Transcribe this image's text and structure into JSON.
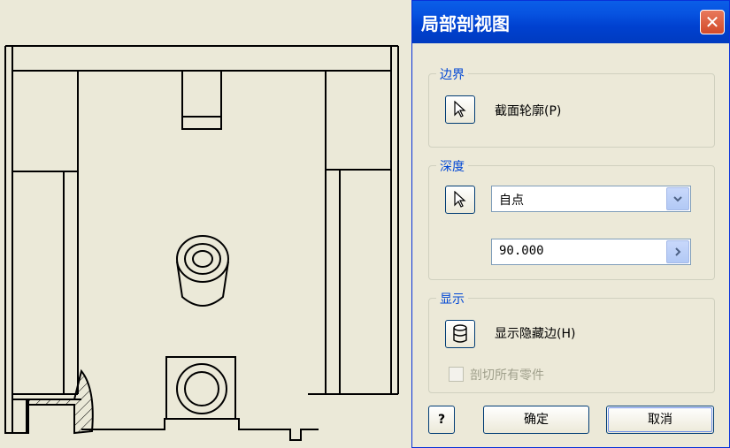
{
  "dialog": {
    "title": "局部剖视图",
    "close_label": "✕",
    "boundary": {
      "group_label": "边界",
      "profile_label": "截面轮廓(P)"
    },
    "depth": {
      "group_label": "深度",
      "mode_value": "自点",
      "distance_value": "90.000"
    },
    "display": {
      "group_label": "显示",
      "show_hidden_label": "显示隐藏边(H)",
      "cut_all_parts_label": "剖切所有零件"
    },
    "buttons": {
      "help_label": "?",
      "ok_label": "确定",
      "cancel_label": "取消"
    }
  },
  "colors": {
    "drawing_background": "#ebe9d8",
    "title_bar": "#0753e0",
    "group_label": "#0046d5",
    "close_button": "#d24a2a"
  },
  "icons": {
    "close": "close-icon",
    "select": "arrow-cursor-icon",
    "hidden_edges": "cylinder-icon",
    "dropdown": "chevron-down-icon",
    "advance": "chevron-right-icon"
  }
}
